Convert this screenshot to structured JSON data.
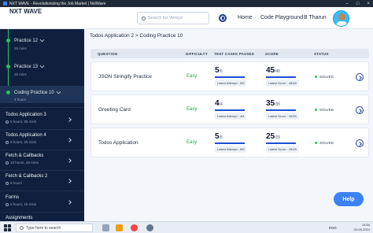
{
  "window": {
    "title": "NXT WAVE - Revolutionizing the Job Market | NxtWave"
  },
  "header": {
    "logo_text": "NXT WAVE",
    "search_placeholder": "Search for 'Arrays'",
    "nav": {
      "home": "Home",
      "code_playground": "Code Playground",
      "user_name": "B Tharun"
    }
  },
  "sidebar": {
    "practices": [
      {
        "title": "Practice 12",
        "meta": "25 mins"
      },
      {
        "title": "Practice 13",
        "meta": "25 mins"
      },
      {
        "title": "Coding Practice 10",
        "meta": "3 hours"
      }
    ],
    "sections": [
      {
        "title": "Todos Application 3",
        "meta": "6 hours, 55 mins"
      },
      {
        "title": "Todos Application 4",
        "meta": "6 hours, 25 mins"
      },
      {
        "title": "Fetch & Callbacks",
        "meta": "10 hours, 45 mins"
      },
      {
        "title": "Fetch & Callbacks 2",
        "meta": "8 hours"
      },
      {
        "title": "Forms",
        "meta": "6 hours, 15 mins"
      },
      {
        "title": "Assignments",
        "meta": ""
      }
    ]
  },
  "main": {
    "breadcrumb": "Todos Application 2 > Coding Practice 10",
    "columns": {
      "question": "QUESTION",
      "difficulty": "DIFFICULTY",
      "test_cases": "TEST CASES PASSED",
      "score": "SCORE",
      "status": "STATUS"
    },
    "rows": [
      {
        "question": "JSON Stringify Practice",
        "difficulty": "Easy",
        "tc_big": "5",
        "tc_small": "/5",
        "tc_progress": 1.0,
        "tc_pill": "Latest Attempt : 5/5",
        "sc_big": "45",
        "sc_small": "/45",
        "sc_progress": 1.0,
        "sc_pill": "Latest Score : 45/45",
        "status": "SOLVED"
      },
      {
        "question": "Greeting Card",
        "difficulty": "Easy",
        "tc_big": "4",
        "tc_small": "/4",
        "tc_progress": 1.0,
        "tc_pill": "Latest Attempt : 4/4",
        "sc_big": "35",
        "sc_small": "/35",
        "sc_progress": 1.0,
        "sc_pill": "Latest Score : 35/35",
        "status": "SOLVED"
      },
      {
        "question": "Todos Application",
        "difficulty": "Easy",
        "tc_big": "5",
        "tc_small": "/5",
        "tc_progress": 1.0,
        "tc_pill": "Latest Attempt : 5/5",
        "sc_big": "25",
        "sc_small": "/25",
        "sc_progress": 1.0,
        "sc_pill": "Latest Score : 25/25",
        "status": "SOLVED"
      }
    ]
  },
  "help_label": "Help",
  "taskbar": {
    "search_placeholder": "Type here to search",
    "lang": "ENG",
    "time": "14:54",
    "date": "03-09-2024"
  },
  "colors": {
    "accent": "#3b82f6",
    "sidebar_bg": "#0f1f3d",
    "success": "#22c55e",
    "easy": "#16a34a"
  }
}
